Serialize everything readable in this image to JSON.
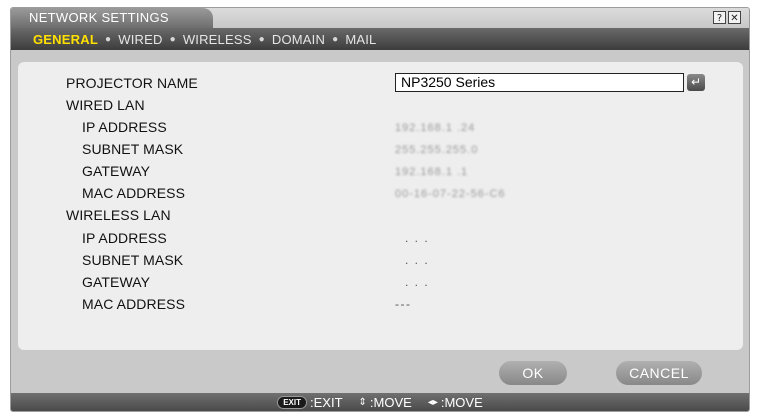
{
  "window": {
    "title": "NETWORK SETTINGS"
  },
  "titlebar_icons": {
    "help": "?",
    "close": "✕"
  },
  "tabs": [
    {
      "label": "GENERAL",
      "active": true
    },
    {
      "label": "WIRED",
      "active": false
    },
    {
      "label": "WIRELESS",
      "active": false
    },
    {
      "label": "DOMAIN",
      "active": false
    },
    {
      "label": "MAIL",
      "active": false
    }
  ],
  "tab_separator": "●",
  "projector_name": {
    "label": "PROJECTOR NAME",
    "value": "NP3250 Series",
    "enter_icon": "↵"
  },
  "wired_lan": {
    "heading": "WIRED LAN",
    "ip_label": "IP ADDRESS",
    "ip_value": "192.168.1 .24",
    "subnet_label": "SUBNET MASK",
    "subnet_value": "255.255.255.0",
    "gateway_label": "GATEWAY",
    "gateway_value": "192.168.1 .1",
    "mac_label": "MAC ADDRESS",
    "mac_value": "00-16-07-22-56-C6"
  },
  "wireless_lan": {
    "heading": "WIRELESS LAN",
    "ip_label": "IP ADDRESS",
    "ip_value": ". . .",
    "subnet_label": "SUBNET MASK",
    "subnet_value": ". . .",
    "gateway_label": "GATEWAY",
    "gateway_value": ". . .",
    "mac_label": "MAC ADDRESS",
    "mac_value": "---"
  },
  "buttons": {
    "ok": "OK",
    "cancel": "CANCEL"
  },
  "footer": {
    "exit_key": "EXIT",
    "exit_label": ":EXIT",
    "updown_icon": "⇕",
    "updown_label": ":MOVE",
    "leftright_icon": "◂▸",
    "leftright_label": ":MOVE"
  },
  "colors": {
    "active_tab": "#ffe000",
    "tab_bar": "#4a4a4a",
    "panel": "#eeeeee",
    "button": "#999999"
  }
}
